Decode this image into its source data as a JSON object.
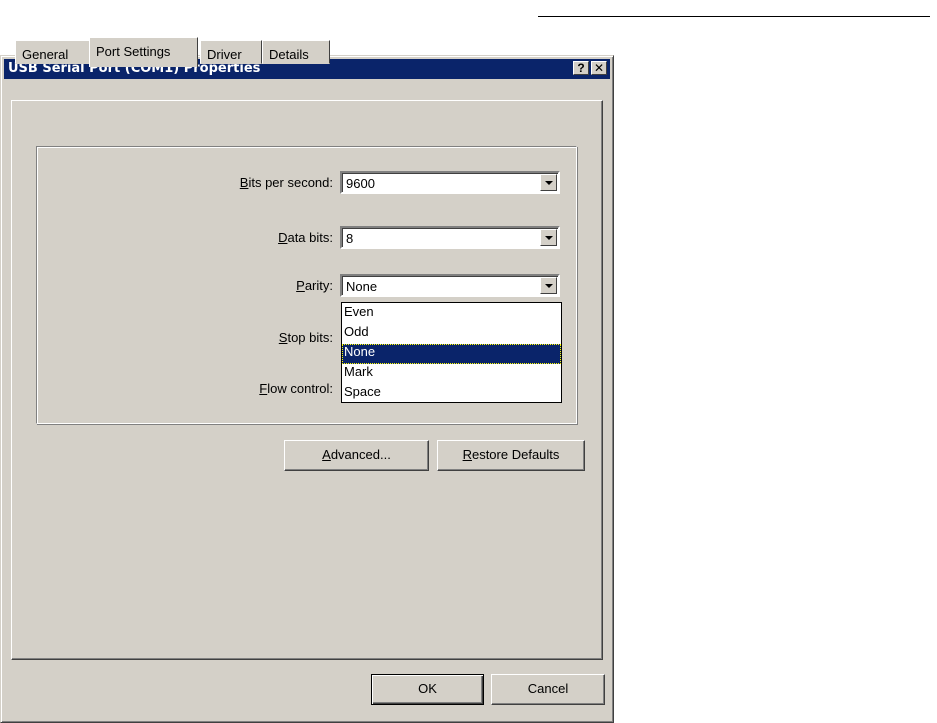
{
  "window": {
    "title": "USB Serial Port (COM1) Properties",
    "help_label": "?",
    "close_label": "✕"
  },
  "tabs": [
    {
      "label": "General"
    },
    {
      "label": "Port Settings"
    },
    {
      "label": "Driver"
    },
    {
      "label": "Details"
    }
  ],
  "active_tab": "Port Settings",
  "settings": {
    "bits_per_second": {
      "key": "B",
      "rest": "its per second:",
      "value": "9600"
    },
    "data_bits": {
      "key": "D",
      "rest": "ata bits:",
      "value": "8"
    },
    "parity": {
      "key": "P",
      "rest": "arity:",
      "value": "None"
    },
    "stop_bits": {
      "key": "S",
      "rest": "top bits:"
    },
    "flow_control": {
      "key": "F",
      "rest": "low control:"
    }
  },
  "parity_options": [
    "Even",
    "Odd",
    "None",
    "Mark",
    "Space"
  ],
  "parity_selected": "None",
  "buttons": {
    "advanced": {
      "key": "A",
      "rest": "dvanced..."
    },
    "restore": {
      "key": "R",
      "rest": "estore Defaults"
    },
    "ok": "OK",
    "cancel": "Cancel"
  },
  "colors": {
    "titlebar": "#0a246a",
    "face": "#d4d0c8",
    "highlight": "#0a246a"
  }
}
